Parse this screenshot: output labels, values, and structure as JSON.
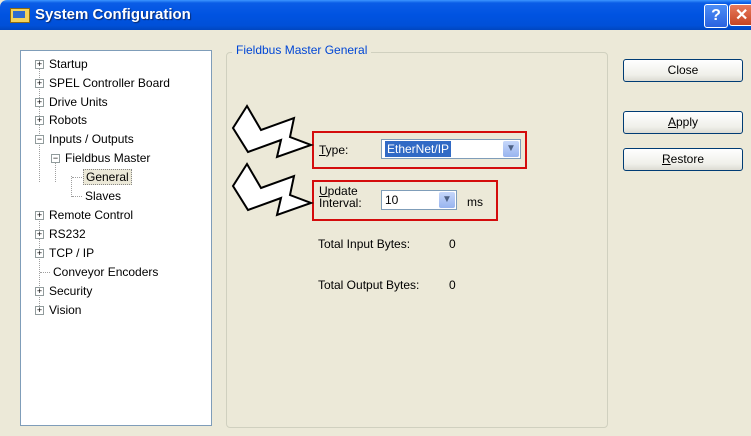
{
  "window": {
    "title": "System Configuration",
    "help": "?",
    "close": "✕"
  },
  "tree": [
    {
      "label": "Startup",
      "exp": "+"
    },
    {
      "label": "SPEL Controller Board",
      "exp": "+"
    },
    {
      "label": "Drive Units",
      "exp": "+"
    },
    {
      "label": "Robots",
      "exp": "+"
    },
    {
      "label": "Inputs / Outputs",
      "exp": "−"
    },
    {
      "label": "Fieldbus Master",
      "exp": "−"
    },
    {
      "label": "General",
      "selected": true
    },
    {
      "label": "Slaves"
    },
    {
      "label": "Remote Control",
      "exp": "+"
    },
    {
      "label": "RS232",
      "exp": "+"
    },
    {
      "label": "TCP / IP",
      "exp": "+"
    },
    {
      "label": "Conveyor Encoders"
    },
    {
      "label": "Security",
      "exp": "+"
    },
    {
      "label": "Vision",
      "exp": "+"
    }
  ],
  "panel": {
    "group_title": "Fieldbus Master General",
    "type_label_u": "T",
    "type_label_rest": "ype:",
    "type_value": "EtherNet/IP",
    "update_label_u": "U",
    "update_label_line1_rest": "pdate",
    "update_label_line2": "Interval:",
    "update_value": "10",
    "update_unit": "ms",
    "total_input_label": "Total Input Bytes:",
    "total_input_value": "0",
    "total_output_label": "Total Output Bytes:",
    "total_output_value": "0"
  },
  "buttons": {
    "close": "Close",
    "apply_u": "A",
    "apply_rest": "pply",
    "restore_u": "R",
    "restore_rest": "estore"
  }
}
